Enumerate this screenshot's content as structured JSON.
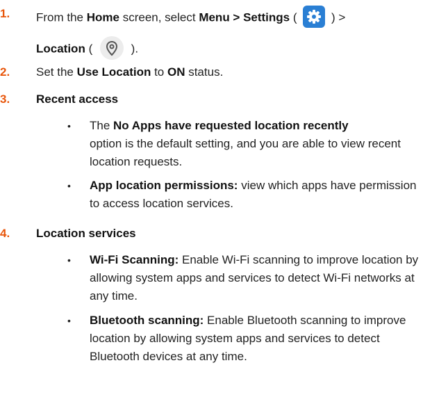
{
  "steps": [
    {
      "number": "1.",
      "line1_a": "From the ",
      "line1_b": "Home",
      "line1_c": " screen, select ",
      "line1_d": "Menu > Settings",
      "line1_e": " ( ",
      "line1_f": " ) >",
      "line2_a": "Location",
      "line2_b": " ( ",
      "line2_c": " )."
    },
    {
      "number": "2.",
      "a": "Set the ",
      "b": "Use Location",
      "c": " to ",
      "d": "ON",
      "e": " status."
    },
    {
      "number": "3.",
      "title": "Recent access",
      "bullets": [
        {
          "pre": "The ",
          "bold": "No Apps have requested location recently",
          "rest": "option is the default setting, and you are able to view recent location requests."
        },
        {
          "bold": "App location permissions:",
          "rest": " view which apps have permission to access location services."
        }
      ]
    },
    {
      "number": "4.",
      "title": "Location services",
      "bullets": [
        {
          "bold": "Wi-Fi Scanning:",
          "rest": " Enable Wi-Fi scanning to improve location by allowing system apps and services to detect Wi-Fi networks at any time."
        },
        {
          "bold": "Bluetooth scanning:",
          "rest": " Enable Bluetooth scanning to improve location by allowing system apps and services to detect Bluetooth devices at any time."
        }
      ]
    }
  ],
  "bullet_char": "•",
  "icons": {
    "settings": "gear-icon",
    "location": "location-pin-icon"
  },
  "colors": {
    "step_number": "#e8560b",
    "settings_icon_bg": "#2a7fd4",
    "location_icon_bg": "#ececec"
  }
}
